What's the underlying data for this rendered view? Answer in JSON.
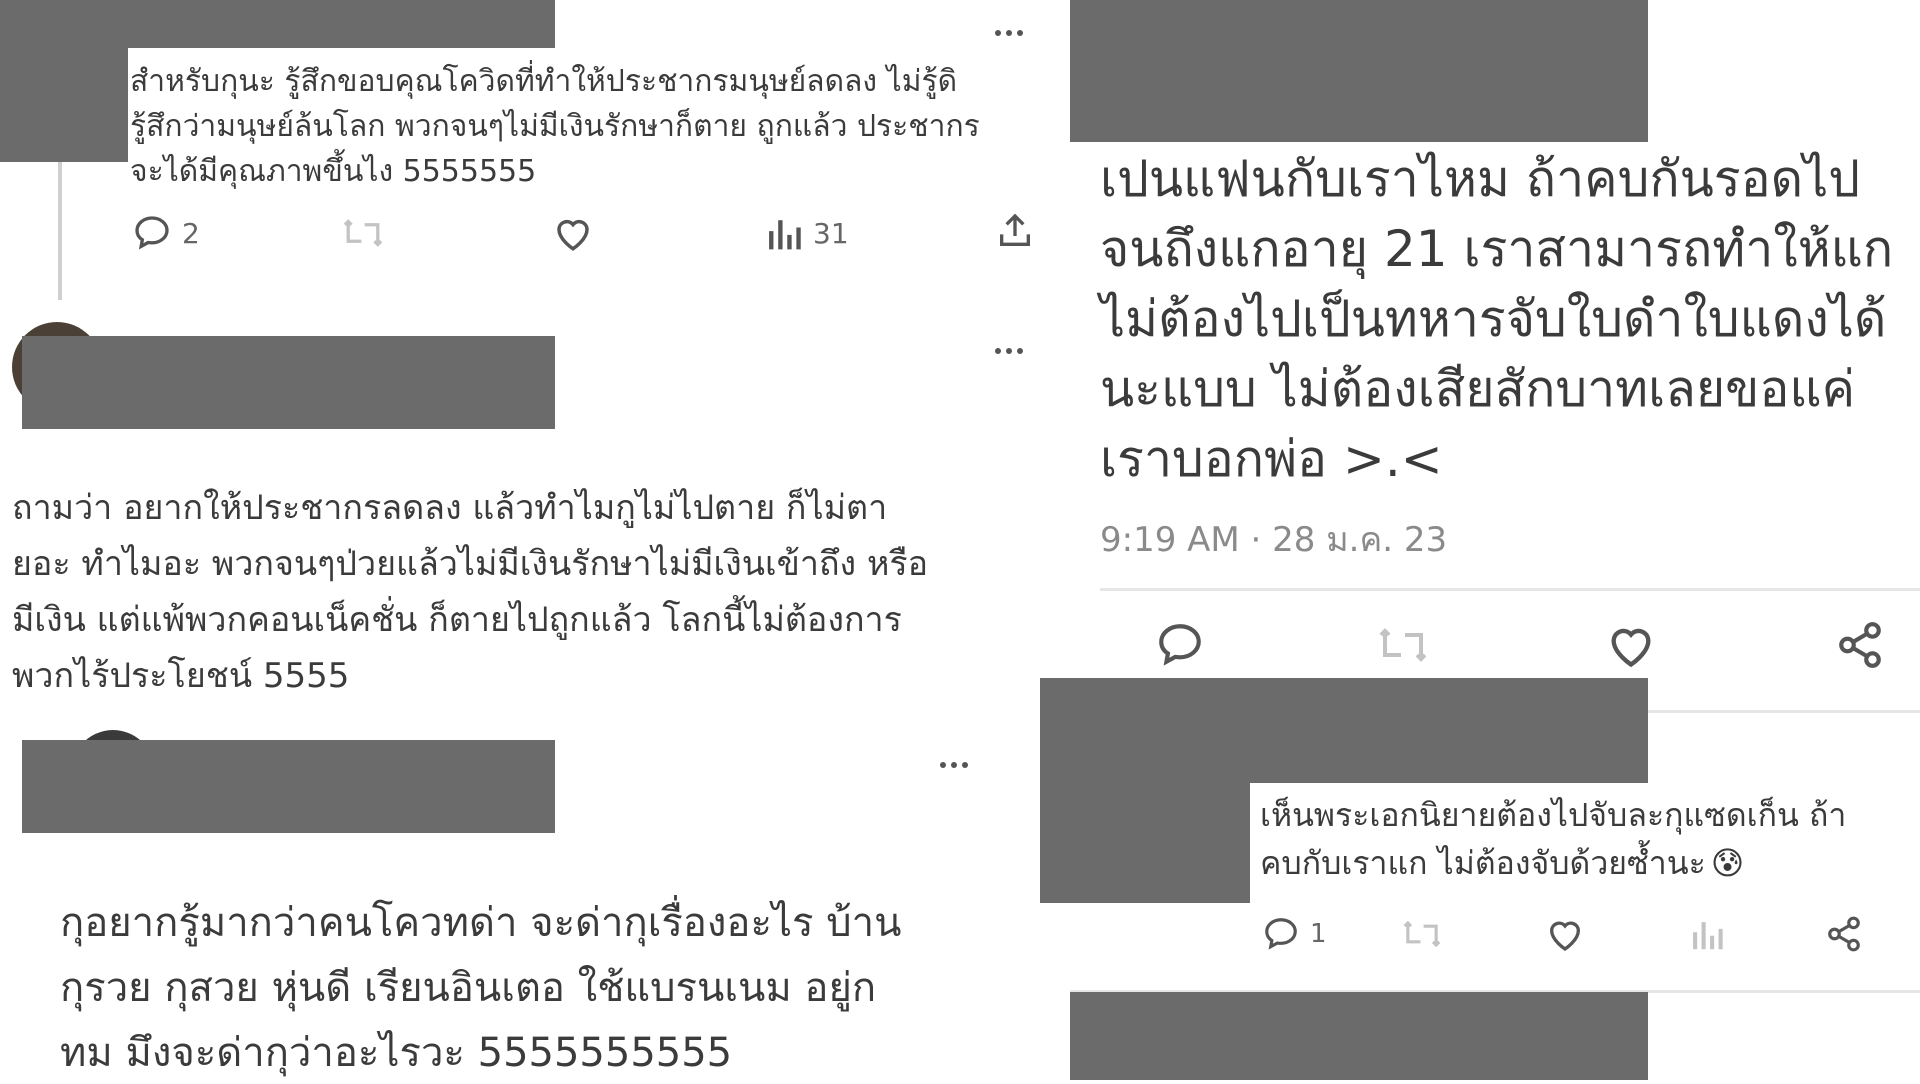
{
  "post1": {
    "text_lines": [
      "สำหรับกุนะ รู้สึกขอบคุณโควิดที่ทำให้ประชากรมนุษย์ลดลง ไม่รู้ดิ",
      "รู้สึกว่ามนุษย์ล้นโลก พวกจนๆไม่มีเงินรักษาก็ตาย ถูกแล้ว ประชากร",
      "จะได้มีคุณภาพขึ้นไง 5555555"
    ],
    "reply_count": "2",
    "view_count": "31"
  },
  "post2": {
    "text_lines": [
      "ถามว่า อยากให้ประชากรลดลง แล้วทำไมกูไม่ไปตาย ก็ไม่ตา",
      "ยอะ ทำไมอะ พวกจนๆป่วยแล้วไม่มีเงินรักษาไม่มีเงินเข้าถึง หรือ",
      "มีเงิน แต่แพ้พวกคอนเน็คชั่น ก็ตายไปถูกแล้ว โลกนี้ไม่ต้องการ",
      "พวกไร้ประโยชน์ 5555"
    ]
  },
  "post3": {
    "text_lines": [
      "กุอยากรู้มากว่าคนโควทด่า จะด่ากุเรื่องอะไร บ้าน",
      "กุรวย กุสวย หุ่นดี เรียนอินเตอ ใช้แบรนเนม อยู่ก",
      "ทม มึงจะด่ากุว่าอะไรวะ 5555555555"
    ]
  },
  "post4": {
    "text_lines": [
      "เปนแฟนกับเราไหม ถ้าคบกันรอดไป",
      "จนถึงแกอายุ 21 เราสามารถทำให้แก",
      "ไม่ต้องไปเป็นทหารจับใบดำใบแดงได้",
      "นะแบบ ไม่ต้องเสียสักบาทเลยขอแค่",
      "เราบอกพ่อ >.<"
    ],
    "timestamp": "9:19 AM · 28 ม.ค. 23"
  },
  "post5": {
    "text_lines": [
      "เห็นพระเอกนิยายต้องไปจับละกุแซดเก็น ถ้า",
      "คบกับเราแก ไม่ต้องจับด้วยซ้ำนะ"
    ],
    "emoji": "😰",
    "reply_count": "1"
  },
  "icons": {
    "reply": "reply-icon",
    "retweet": "retweet-icon",
    "like": "heart-icon",
    "views": "views-icon",
    "share": "share-icon",
    "more": "more-icon"
  },
  "colors": {
    "redaction": "#6b6b6b",
    "text": "#3b3b3b",
    "meta": "#8a8a8a"
  }
}
